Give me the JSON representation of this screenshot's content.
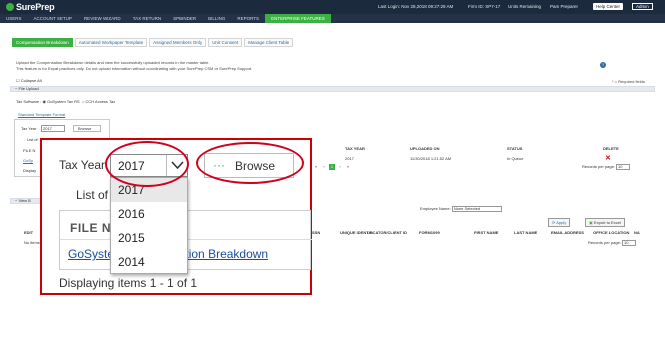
{
  "app": {
    "logo": "SurePrep",
    "last_login": "Last Login:  Nov 28,2018 09:27:29 AM",
    "firm_id": "Firm ID:  SP7-17",
    "units": "Units Remaining",
    "user": "Pam Preparer",
    "help": "Help Center",
    "admin": "Admin"
  },
  "nav": [
    "USERS",
    "ACCOUNT SETUP",
    "REVIEW WIZARD",
    "TAX RETURN",
    "SPBINDER",
    "BILLING",
    "REPORTS",
    "ENTERPRISE FEATURES"
  ],
  "subtabs": [
    "Compensation Breakdown",
    "Automated Workpaper Template",
    "Assigned Members Only",
    "Unit Consent",
    "Manage Client Table"
  ],
  "intro": {
    "line1": "Upload the Compensation Breakdown details and view the successfully uploaded records in the master table.",
    "line2": "This feature is for Expat practices only. Do not upload information without coordinating with your SurePrep CSM or SurePrep Support."
  },
  "required_fields": "= Required fields",
  "collapse_all": "Collapse All",
  "file_upload_label": "File Upload",
  "software": {
    "label": "Tax Software :",
    "opt1": "GoSystem Tax RS",
    "opt2": "CCH Axcess Tax"
  },
  "standard_template": "Standard Template Format",
  "mini": {
    "tax_year": "Tax Year",
    "year": "2017",
    "browse": "Browse",
    "list_of": "List of",
    "file": "FILE N",
    "gosys": "GoSy",
    "displaying": "Display"
  },
  "upload_table": {
    "headers": [
      "TAX YEAR",
      "UPLOADED ON",
      "STATUS",
      "DELETE"
    ],
    "row": [
      "2017",
      "11/30/2018 1:21:52 AM",
      "In Queue"
    ],
    "records_per_page": "Records per page:",
    "per_page_value": "10"
  },
  "view_section_label": "View B",
  "employee_filter": {
    "label": "Employee Name:",
    "value": "None Selected",
    "apply": "Apply",
    "export": "Export to Excel"
  },
  "grid_headers": [
    "EDIT",
    "SSN",
    "UNIQUE IDENTIF.",
    "LOCATOR/CLIENT ID",
    "FORM1099",
    "FIRST NAME",
    "LAST NAME",
    "EMAIL ADDRESS",
    "OFFICE LOCATION",
    "NA"
  ],
  "grid_records_per_page": "Records per page:",
  "grid_no_items": "No items",
  "zoom": {
    "tax_year_label": "Tax Year",
    "selected_year": "2017",
    "options": [
      "2017",
      "2016",
      "2015",
      "2014"
    ],
    "browse": "Browse",
    "list_of": "List of",
    "file_name_header": "FILE NA",
    "file_link": "GoSystem Compensation Breakdown",
    "displaying": "Displaying items 1 - 1 of 1"
  },
  "colors": {
    "accent": "#3cb043",
    "header_bg": "#1c2a3d",
    "highlight_ring": "#d0021b",
    "link": "#1a4fa0"
  }
}
